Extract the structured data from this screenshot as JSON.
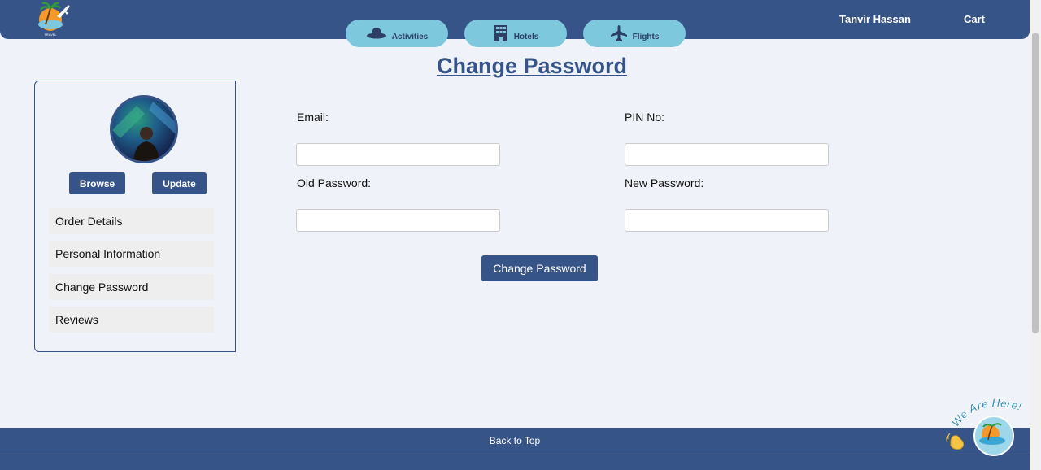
{
  "header": {
    "user_name": "Tanvir Hassan",
    "cart_label": "Cart",
    "nav": [
      {
        "label": "Activities",
        "icon": "hat-icon"
      },
      {
        "label": "Hotels",
        "icon": "building-icon"
      },
      {
        "label": "Flights",
        "icon": "plane-icon"
      }
    ]
  },
  "main": {
    "title": "Change Password",
    "fields": {
      "email": {
        "label": "Email:",
        "value": ""
      },
      "pin": {
        "label": "PIN No:",
        "value": ""
      },
      "old_password": {
        "label": "Old Password:",
        "value": ""
      },
      "new_password": {
        "label": "New Password:",
        "value": ""
      }
    },
    "submit_label": "Change Password"
  },
  "sidebar": {
    "browse_label": "Browse",
    "update_label": "Update",
    "items": [
      {
        "label": "Order Details"
      },
      {
        "label": "Personal Information"
      },
      {
        "label": "Change Password"
      },
      {
        "label": "Reviews"
      }
    ]
  },
  "footer": {
    "back_to_top": "Back to Top"
  },
  "chat_widget": {
    "text": "We Are Here!"
  },
  "colors": {
    "primary": "#375489",
    "nav_pill": "#7ec8de",
    "background": "#eff2f8"
  }
}
